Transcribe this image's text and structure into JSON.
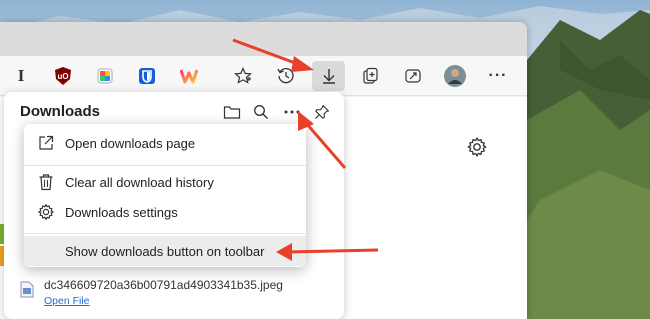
{
  "colors": {
    "accent_arrow": "#e8402a",
    "link": "#2c6bc9",
    "ublock_red": "#800000",
    "bitwarden_blue": "#175ddc",
    "extension_gradient": [
      "#f36",
      "#fc3"
    ]
  },
  "toolbar": {
    "items": [
      {
        "icon": "ibooks-glyph-icon",
        "glyph": "I"
      },
      {
        "icon": "ublock-origin-icon",
        "glyph": "uO"
      },
      {
        "icon": "color-picker-extension-icon"
      },
      {
        "icon": "bitwarden-icon"
      },
      {
        "icon": "w-extension-icon",
        "glyph": "w"
      },
      {
        "icon": "favorites-star-icon"
      },
      {
        "icon": "history-icon"
      },
      {
        "icon": "downloads-arrow-icon",
        "active": true
      },
      {
        "icon": "collections-icon"
      },
      {
        "icon": "web-capture-icon"
      },
      {
        "icon": "profile-avatar-icon"
      },
      {
        "icon": "more-options-icon",
        "glyph": "···"
      }
    ]
  },
  "downloads_panel": {
    "title": "Downloads",
    "file": {
      "name": "dc346609720a36b00791ad4903341b35.jpeg",
      "action": "Open File"
    }
  },
  "context_menu": {
    "items": [
      {
        "icon": "external-link-icon",
        "label": "Open downloads page"
      },
      {
        "icon": "trash-icon",
        "label": "Clear all download history"
      },
      {
        "icon": "settings-gear-icon",
        "label": "Downloads settings"
      },
      {
        "icon": "",
        "label": "Show downloads button on toolbar",
        "highlighted": true
      }
    ]
  }
}
